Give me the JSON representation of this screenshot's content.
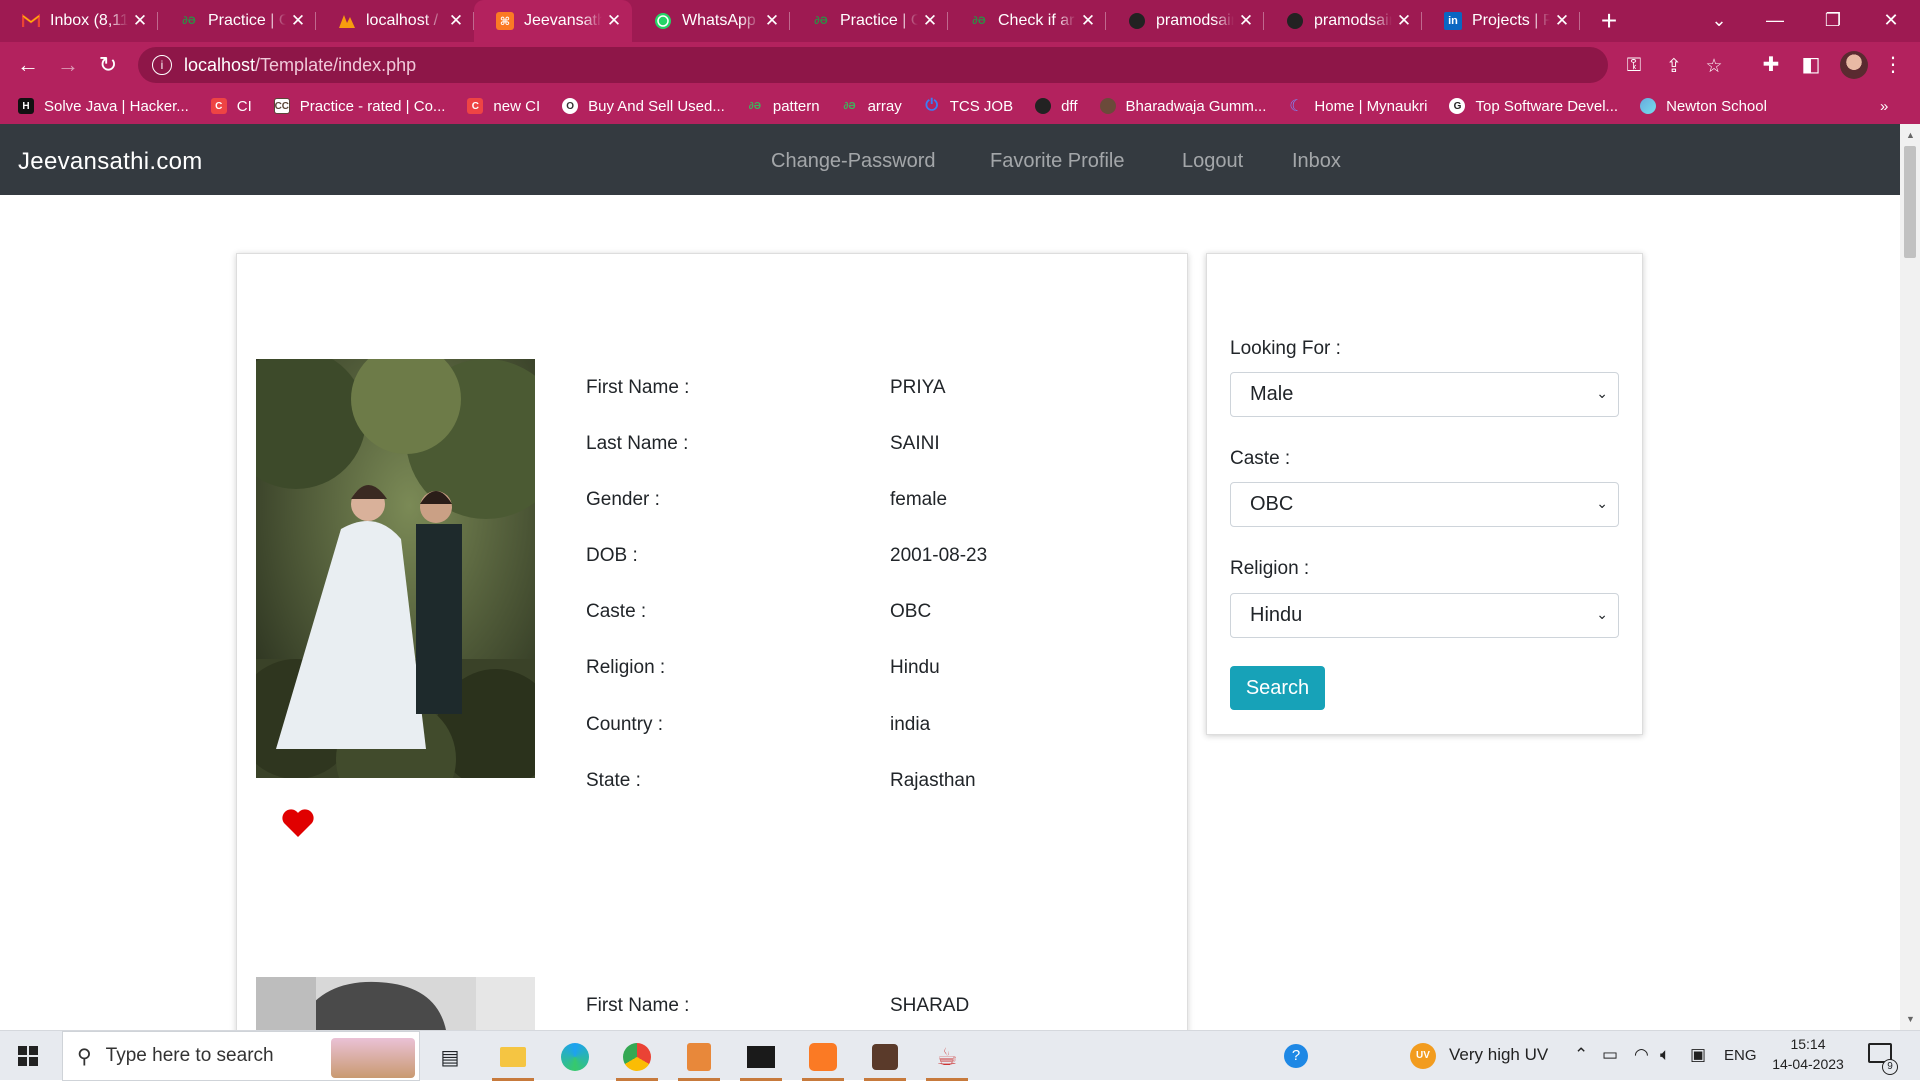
{
  "browser": {
    "tabs": [
      {
        "title": "Inbox (8,11",
        "icon": "gmail-icon",
        "active": false
      },
      {
        "title": "Practice | G",
        "icon": "gfg-icon",
        "active": false
      },
      {
        "title": "localhost /",
        "icon": "phpmyadmin-icon",
        "active": false
      },
      {
        "title": "Jeevansathi",
        "icon": "xampp-icon",
        "active": true
      },
      {
        "title": "WhatsApp",
        "icon": "whatsapp-icon",
        "active": false
      },
      {
        "title": "Practice | G",
        "icon": "gfg-icon",
        "active": false
      },
      {
        "title": "Check if arr",
        "icon": "gfg-icon",
        "active": false
      },
      {
        "title": "pramodsain",
        "icon": "github-icon",
        "active": false
      },
      {
        "title": "pramodsain",
        "icon": "github-icon",
        "active": false
      },
      {
        "title": "Projects | P",
        "icon": "linkedin-icon",
        "active": false
      }
    ],
    "url_host": "localhost",
    "url_path": "/Template/index.php",
    "bookmarks": [
      {
        "label": "Solve Java | Hacker...",
        "icon": "hackerrank-icon"
      },
      {
        "label": "CI",
        "icon": "ci-icon"
      },
      {
        "label": "Practice - rated | Co...",
        "icon": "codechef-icon"
      },
      {
        "label": "new CI",
        "icon": "ci-icon"
      },
      {
        "label": "Buy And Sell Used...",
        "icon": "olx-icon"
      },
      {
        "label": "pattern",
        "icon": "gfg-icon"
      },
      {
        "label": "array",
        "icon": "gfg-icon"
      },
      {
        "label": "TCS JOB",
        "icon": "power-icon"
      },
      {
        "label": "dff",
        "icon": "github-icon"
      },
      {
        "label": "Bharadwaja Gumm...",
        "icon": "avatar-icon"
      },
      {
        "label": "Home | Mynaukri",
        "icon": "mynaukri-icon"
      },
      {
        "label": "Top Software Devel...",
        "icon": "globe-icon"
      },
      {
        "label": "Newton School",
        "icon": "newton-icon"
      }
    ],
    "bookmarks_overflow": "»"
  },
  "site": {
    "brand": "Jeevansathi.com",
    "nav": [
      "Change-Password",
      "Favorite Profile",
      "Logout",
      "Inbox"
    ]
  },
  "profiles": [
    {
      "first_name_label": "First Name :",
      "first_name": "PRIYA",
      "last_name_label": "Last Name :",
      "last_name": "SAINI",
      "gender_label": "Gender :",
      "gender": "female",
      "dob_label": "DOB :",
      "dob": "2001-08-23",
      "caste_label": "Caste :",
      "caste": "OBC",
      "religion_label": "Religion :",
      "religion": "Hindu",
      "country_label": "Country :",
      "country": "india",
      "state_label": "State :",
      "state": "Rajasthan"
    },
    {
      "first_name_label": "First Name :",
      "first_name": "SHARAD"
    }
  ],
  "search_form": {
    "looking_for_label": "Looking For :",
    "looking_for": "Male",
    "caste_label": "Caste :",
    "caste": "OBC",
    "religion_label": "Religion :",
    "religion": "Hindu",
    "search_button": "Search"
  },
  "taskbar": {
    "search_placeholder": "Type here to search",
    "weather_badge": "UV",
    "weather": "Very high UV",
    "lang": "ENG",
    "time": "15:14",
    "date": "14-04-2023",
    "notifications": "9"
  },
  "colors": {
    "chrome": "#9e1a52",
    "navbar": "#343a40",
    "accent": "#17a2b8",
    "heart": "#e00000"
  }
}
